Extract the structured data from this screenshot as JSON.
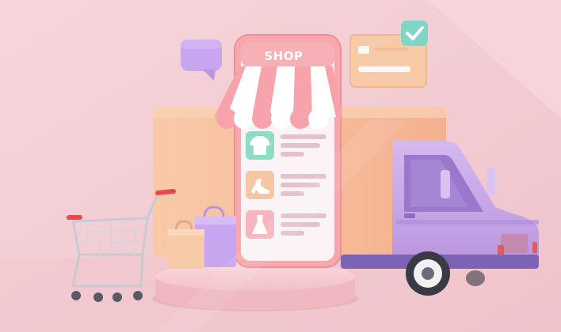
{
  "scene": {
    "shop_sign": "SHOP",
    "colors": {
      "background": "#f3cdd3",
      "phone": "#f6a8ae",
      "screen": "#fbf3f6",
      "truck": "#c9a9e7",
      "box": "#f7bd9d",
      "check_badge": "#7fd6c4",
      "product_tile_green": "#8fdcc4",
      "product_tile_peach": "#f7c7a5",
      "product_tile_pink": "#f7b6bf",
      "cart_handle": "#e84a4a"
    },
    "icons": [
      "chat-bubble-icon",
      "credit-card-icon",
      "check-icon",
      "shirt-icon",
      "shoe-icon",
      "dress-icon",
      "shopping-cart-icon",
      "shopping-bag-icon",
      "delivery-truck-icon"
    ]
  }
}
